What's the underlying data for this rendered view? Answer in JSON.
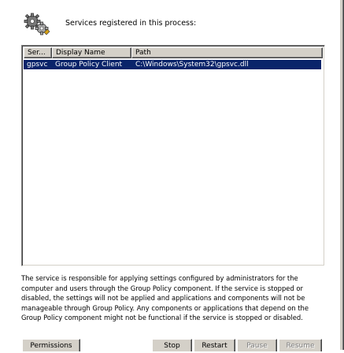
{
  "header": {
    "icon": "gears-icon",
    "text": "Services registered in this process:"
  },
  "services_list": {
    "columns": [
      "Ser...",
      "Display Name",
      "Path"
    ],
    "rows": [
      {
        "service": "gpsvc",
        "display_name": "Group Policy Client",
        "path": "C:\\Windows\\System32\\gpsvc.dll",
        "selected": true
      }
    ],
    "selection_color": "#0a246a"
  },
  "description": "The service is responsible for applying settings configured by administrators for the computer and users through the Group Policy component. If the service is stopped or disabled, the settings will not be applied and applications and components will not be manageable through Group Policy. Any components or applications that depend on the Group Policy component might not be functional if the service is stopped or disabled.",
  "buttons": {
    "permissions": "Permissions",
    "stop": "Stop",
    "restart": "Restart",
    "pause": "Pause",
    "resume": "Resume"
  }
}
